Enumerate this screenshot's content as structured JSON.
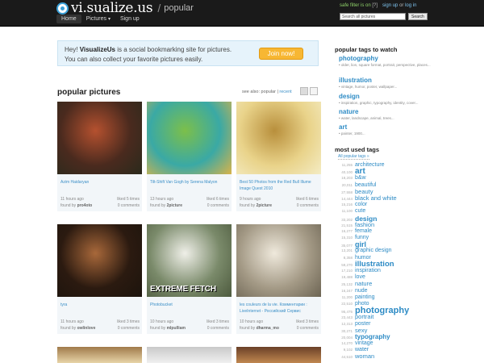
{
  "header": {
    "logo_text": "vi.sualize.us",
    "separator": "/",
    "section": "popular",
    "nav": [
      {
        "label": "Home"
      },
      {
        "label": "Pictures"
      },
      {
        "label": "Sign up"
      }
    ],
    "nav_caret": "▾",
    "safe_filter": "safe filter is on",
    "safe_filter_help": "[?]",
    "signup": "sign up",
    "or": "or",
    "login": "log in",
    "search_placeholder": "Search all pictures",
    "search_button": "Search"
  },
  "banner": {
    "hey": "Hey!",
    "brand": "VisualizeUs",
    "line1_rest": "is a social bookmarking site for pictures.",
    "line2": "You can also collect your favorite pictures easily.",
    "join": "Join now!"
  },
  "popular": {
    "title": "popular pictures",
    "see_also": "see also:",
    "current": "popular",
    "divider": "|",
    "recent": "recent"
  },
  "pictures": [
    {
      "title": "Azim Haidaryan",
      "time": "11 hours ago",
      "liked": "liked 5 times",
      "found_by_label": "found by",
      "user": "pro4oto",
      "comments": "0 comments",
      "colors": [
        "#4a2a1e",
        "#b5512f",
        "#2a2a1c"
      ]
    },
    {
      "title": "Tilt-Shift Van Gogh by Serena Malyon",
      "time": "13 hours ago",
      "liked": "liked 6 times",
      "found_by_label": "found by",
      "user": "2picture",
      "comments": "0 comments",
      "colors": [
        "#3aa9a5",
        "#7cbf4a",
        "#d9b34a"
      ]
    },
    {
      "title": "Best 50 Photos from the Red Bull Illume Image Quest 2010",
      "time": "9 hours ago",
      "liked": "liked 6 times",
      "found_by_label": "found by",
      "user": "2picture",
      "comments": "0 comments",
      "colors": [
        "#e9d38a",
        "#b88f3c",
        "#f4ecc4"
      ]
    },
    {
      "title": "tyra",
      "time": "11 hours ago",
      "liked": "liked 3 times",
      "found_by_label": "found by",
      "user": "owlinlove",
      "comments": "0 comments",
      "colors": [
        "#2b1a10",
        "#a8683a",
        "#1c140d"
      ]
    },
    {
      "title": "Photobucket",
      "time": "10 hours ago",
      "liked": "liked 3 times",
      "found_by_label": "found by",
      "user": "mlpulliam",
      "comments": "0 comments",
      "overlay": "EXTREME FETCH",
      "colors": [
        "#7a8a6a",
        "#efefe8",
        "#4d5a3e"
      ]
    },
    {
      "title": "les couleurs de la vie. Комментарии : LiveInternet - Российский Сервис",
      "time": "10 hours ago",
      "liked": "liked 3 times",
      "found_by_label": "found by",
      "user": "dharma_mo",
      "comments": "0 comments",
      "colors": [
        "#a49a86",
        "#efe9dc",
        "#6c6453"
      ]
    }
  ],
  "watch": {
    "title": "popular tags to watch",
    "tags": [
      {
        "name": "photography",
        "sub": "• older, lion, square format, portrait, perspective, places..."
      },
      {
        "name": "illustration",
        "sub": "• vintage, humor, poster, wallpaper..."
      },
      {
        "name": "design",
        "sub": "• inspiration, graphic, typography, identity, cover..."
      },
      {
        "name": "nature",
        "sub": "• water, landscape, animal, trees..."
      },
      {
        "name": "art",
        "sub": "• painter, 1900..."
      }
    ]
  },
  "most_used": {
    "title": "most used tags",
    "all_link": "All popular tags »",
    "tags": [
      {
        "count": "11,255",
        "name": "architecture",
        "size": 7
      },
      {
        "count": "40,100",
        "name": "art",
        "size": 10
      },
      {
        "count": "18,203",
        "name": "b&w",
        "size": 7
      },
      {
        "count": "20,011",
        "name": "beautiful",
        "size": 7
      },
      {
        "count": "27,558",
        "name": "beauty",
        "size": 7.5
      },
      {
        "count": "14,444",
        "name": "black and white",
        "size": 7.5
      },
      {
        "count": "15,216",
        "name": "color",
        "size": 7
      },
      {
        "count": "11,100",
        "name": "cute",
        "size": 7
      },
      {
        "count": "33,202",
        "name": "design",
        "size": 8.5
      },
      {
        "count": "21,515",
        "name": "fashion",
        "size": 7.5
      },
      {
        "count": "16,277",
        "name": "female",
        "size": 7
      },
      {
        "count": "15,310",
        "name": "funny",
        "size": 7
      },
      {
        "count": "35,077",
        "name": "girl",
        "size": 9
      },
      {
        "count": "13,201",
        "name": "graphic design",
        "size": 7
      },
      {
        "count": "8,358",
        "name": "humor",
        "size": 7
      },
      {
        "count": "59,270",
        "name": "illustration",
        "size": 9.5
      },
      {
        "count": "17,210",
        "name": "inspiration",
        "size": 7
      },
      {
        "count": "19,488",
        "name": "love",
        "size": 7
      },
      {
        "count": "25,132",
        "name": "nature",
        "size": 7.5
      },
      {
        "count": "16,247",
        "name": "nude",
        "size": 7
      },
      {
        "count": "11,200",
        "name": "painting",
        "size": 7
      },
      {
        "count": "22,510",
        "name": "photo",
        "size": 7
      },
      {
        "count": "95,475",
        "name": "photography",
        "size": 11
      },
      {
        "count": "23,443",
        "name": "portrait",
        "size": 7.5
      },
      {
        "count": "12,313",
        "name": "poster",
        "size": 7
      },
      {
        "count": "30,271",
        "name": "sexy",
        "size": 7.5
      },
      {
        "count": "20,004",
        "name": "typography",
        "size": 8
      },
      {
        "count": "14,270",
        "name": "vintage",
        "size": 7
      },
      {
        "count": "9,102",
        "name": "water",
        "size": 7
      },
      {
        "count": "44,510",
        "name": "woman",
        "size": 7.5
      }
    ]
  }
}
